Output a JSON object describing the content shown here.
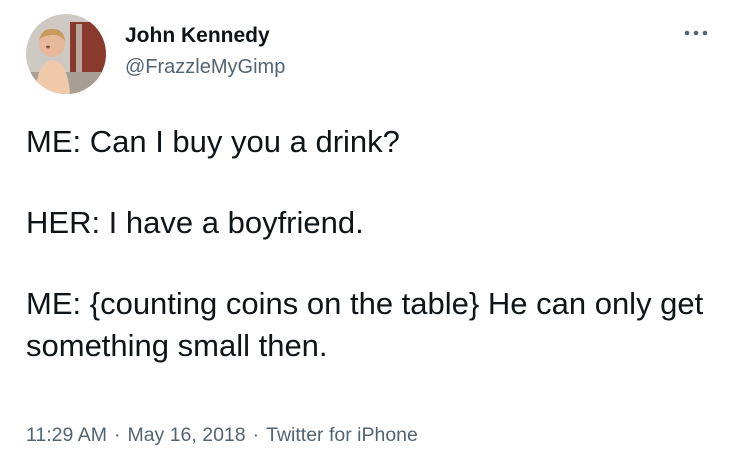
{
  "tweet": {
    "author": {
      "display_name": "John Kennedy",
      "handle": "@FrazzleMyGimp",
      "avatar_icon": "child-photo-avatar"
    },
    "more_icon": "more-horizontal-icon",
    "lines": [
      "ME: Can I buy you a drink?",
      "HER: I have a boyfriend.",
      "ME: {counting coins on the table} He can only get something small then."
    ],
    "meta": {
      "time": "11:29 AM",
      "separator": "·",
      "date": "May 16, 2018",
      "source": "Twitter for iPhone"
    }
  },
  "colors": {
    "text": "#0f1419",
    "secondary_text": "#536471",
    "background": "#ffffff"
  }
}
